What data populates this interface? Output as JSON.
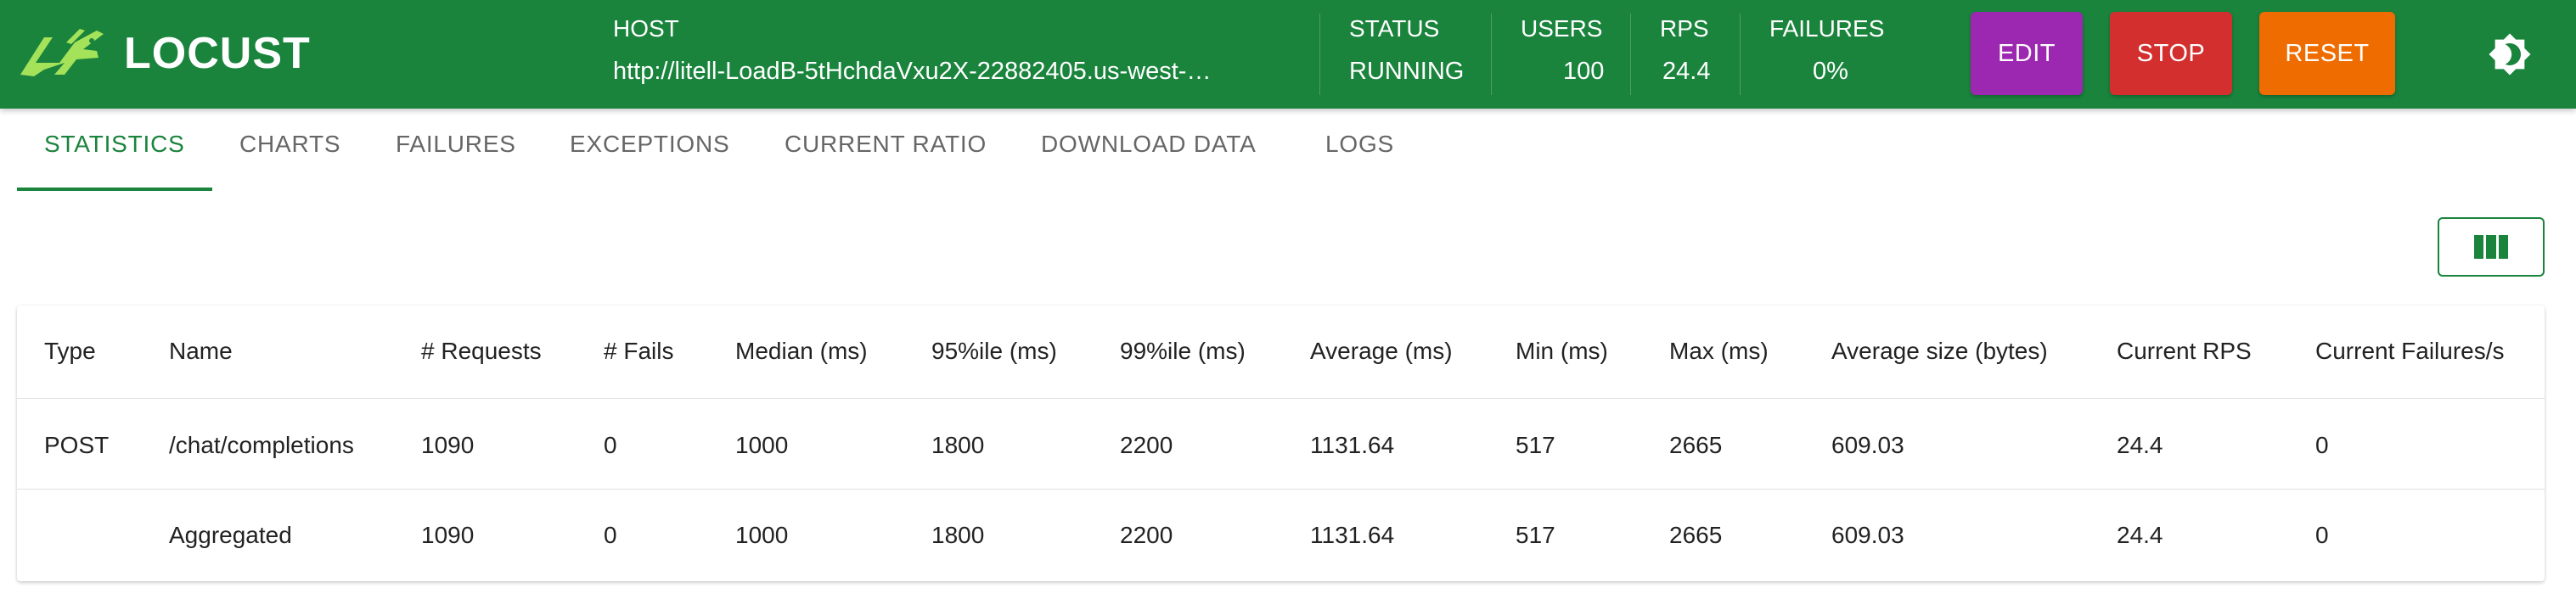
{
  "app": {
    "brand": "LOCUST",
    "brand_color": "#1a843d"
  },
  "header": {
    "host": {
      "label": "HOST",
      "value": "http://litell-LoadB-5tHchdaVxu2X-22882405.us-west-…"
    },
    "status": {
      "label": "STATUS",
      "value": "RUNNING"
    },
    "users": {
      "label": "USERS",
      "value": "100"
    },
    "rps": {
      "label": "RPS",
      "value": "24.4"
    },
    "failures": {
      "label": "FAILURES",
      "value": "0%"
    },
    "buttons": {
      "edit": {
        "label": "EDIT",
        "color": "#9c27b0"
      },
      "stop": {
        "label": "STOP",
        "color": "#d32f2f"
      },
      "reset": {
        "label": "RESET",
        "color": "#ef6c00"
      }
    },
    "theme_toggle_icon": "brightness-icon"
  },
  "tabs": [
    {
      "label": "STATISTICS",
      "active": true
    },
    {
      "label": "CHARTS",
      "active": false
    },
    {
      "label": "FAILURES",
      "active": false
    },
    {
      "label": "EXCEPTIONS",
      "active": false
    },
    {
      "label": "CURRENT RATIO",
      "active": false
    },
    {
      "label": "DOWNLOAD DATA",
      "active": false
    },
    {
      "label": "LOGS",
      "active": false
    }
  ],
  "toolbar": {
    "columns_icon": "view-column-icon"
  },
  "stats_table": {
    "columns": [
      "Type",
      "Name",
      "# Requests",
      "# Fails",
      "Median (ms)",
      "95%ile (ms)",
      "99%ile (ms)",
      "Average (ms)",
      "Min (ms)",
      "Max (ms)",
      "Average size (bytes)",
      "Current RPS",
      "Current Failures/s"
    ],
    "rows": [
      [
        "POST",
        "/chat/completions",
        "1090",
        "0",
        "1000",
        "1800",
        "2200",
        "1131.64",
        "517",
        "2665",
        "609.03",
        "24.4",
        "0"
      ],
      [
        "",
        "Aggregated",
        "1090",
        "0",
        "1000",
        "1800",
        "2200",
        "1131.64",
        "517",
        "2665",
        "609.03",
        "24.4",
        "0"
      ]
    ]
  }
}
